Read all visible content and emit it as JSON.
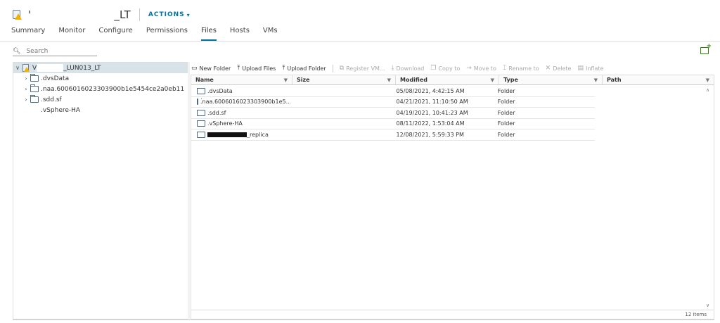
{
  "header": {
    "object_name_suffix": "_LT",
    "actions_label": "ACTIONS"
  },
  "tabs": [
    {
      "label": "Summary"
    },
    {
      "label": "Monitor"
    },
    {
      "label": "Configure"
    },
    {
      "label": "Permissions"
    },
    {
      "label": "Files",
      "active": true
    },
    {
      "label": "Hosts"
    },
    {
      "label": "VMs"
    }
  ],
  "search": {
    "placeholder": "Search"
  },
  "tree": {
    "root": {
      "label_prefix": "V",
      "label_suffix": "_LUN013_LT"
    },
    "items": [
      {
        "label": ".dvsData",
        "expandable": true
      },
      {
        "label": ".naa.6006016023303900b1e5454ce2a0eb11",
        "expandable": true
      },
      {
        "label": ".sdd.sf",
        "expandable": true
      },
      {
        "label": ".vSphere-HA",
        "expandable": false
      }
    ]
  },
  "toolbar": {
    "new_folder": "New Folder",
    "upload_files": "Upload Files",
    "upload_folder": "Upload Folder",
    "register_vm": "Register VM...",
    "download": "Download",
    "copy_to": "Copy to",
    "move_to": "Move to",
    "rename_to": "Rename to",
    "delete": "Delete",
    "inflate": "Inflate"
  },
  "grid": {
    "columns": {
      "name": "Name",
      "size": "Size",
      "modified": "Modified",
      "type": "Type",
      "path": "Path"
    },
    "rows": [
      {
        "name": ".dvsData",
        "size": "",
        "modified": "05/08/2021, 4:42:15 AM",
        "type": "Folder"
      },
      {
        "name": ".naa.6006016023303900b1e5...",
        "size": "",
        "modified": "04/21/2021, 11:10:50 AM",
        "type": "Folder"
      },
      {
        "name": ".sdd.sf",
        "size": "",
        "modified": "04/19/2021, 10:41:23 AM",
        "type": "Folder"
      },
      {
        "name": ".vSphere-HA",
        "size": "",
        "modified": "08/11/2022, 1:53:04 AM",
        "type": "Folder"
      },
      {
        "name_suffix": "_replica",
        "size": "",
        "modified": "12/08/2021, 5:59:33 PM",
        "type": "Folder"
      }
    ],
    "footer": "12 items"
  }
}
